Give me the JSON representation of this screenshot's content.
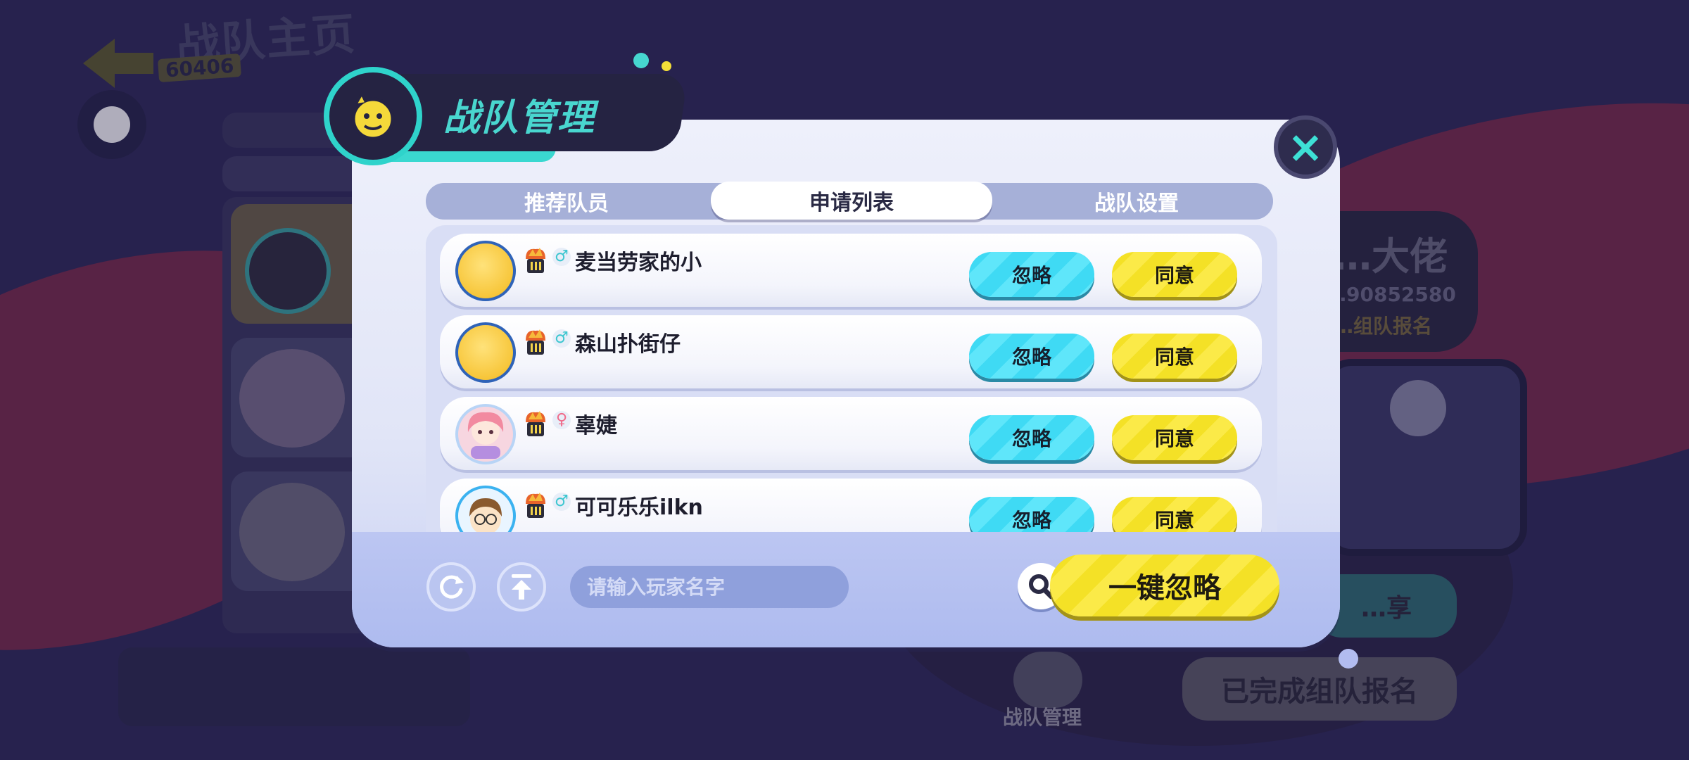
{
  "background": {
    "page_title": "战队主页",
    "page_subtitle": "60406",
    "profile": {
      "name": "…大佬",
      "id": "…90852580",
      "tag": "…组队报名"
    },
    "share_button": "…享",
    "register_done_button": "已完成组队报名",
    "manage_tab": {
      "label": "战队管理",
      "icon": "chat-bubble-icon"
    }
  },
  "modal": {
    "title": "战队管理",
    "close": "×",
    "tabs": [
      {
        "label": "推荐队员",
        "active": false
      },
      {
        "label": "申请列表",
        "active": true
      },
      {
        "label": "战队设置",
        "active": false
      }
    ],
    "applicants": [
      {
        "name": "麦当劳家的小",
        "gender": "male",
        "gender_symbol": "♂",
        "avatar": "default-yellow"
      },
      {
        "name": "森山扑街仔",
        "gender": "male",
        "gender_symbol": "♂",
        "avatar": "default-yellow"
      },
      {
        "name": "辜婕",
        "gender": "female",
        "gender_symbol": "♀",
        "avatar": "anime-girl"
      },
      {
        "name": "可可乐乐ilkn",
        "gender": "male",
        "gender_symbol": "♂",
        "avatar": "cartoon-boy"
      }
    ],
    "row_actions": {
      "ignore": "忽略",
      "agree": "同意"
    },
    "footer": {
      "refresh_icon": "refresh-icon",
      "top_icon": "scroll-top-icon",
      "search_placeholder": "请输入玩家名字",
      "search_value": "",
      "ignore_all": "一键忽略"
    }
  },
  "colors": {
    "accent_cyan": "#3fdaf4",
    "accent_yellow": "#f4e126",
    "title_teal": "#49d6cf",
    "dark_navy": "#252342"
  }
}
